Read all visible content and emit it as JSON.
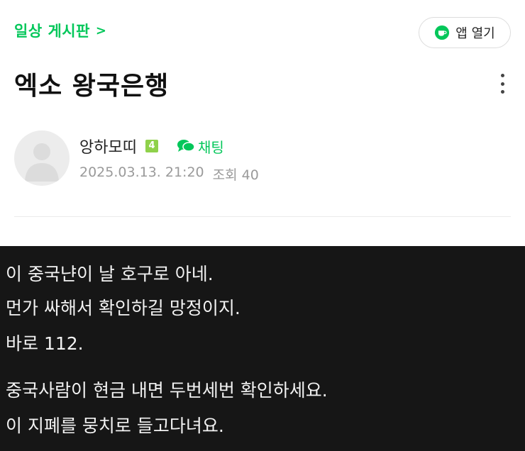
{
  "header": {
    "board_link": "일상 게시판",
    "board_chevron": ">",
    "app_button_label": "앱 열기"
  },
  "post": {
    "title": "엑소 왕국은행",
    "author": "앙하모띠",
    "level": "4",
    "chat_label": "채팅",
    "date": "2025.03.13. 21:20",
    "views": "조회 40"
  },
  "body": {
    "lines": [
      "이 중국냔이 날 호구로 아네.",
      "먼가 싸해서 확인하길 망정이지.",
      "바로 112.",
      "중국사람이 현금 내면 두번세번 확인하세요.",
      "이 지폐를 뭉치로 들고다녀요."
    ]
  },
  "colors": {
    "accent": "#03c75a",
    "level_badge": "#8fd14a",
    "dark_background": "#161616"
  },
  "icons": [
    "coffee-cup-icon",
    "more-vertical-icon",
    "avatar-placeholder-icon",
    "chat-bubble-icon"
  ]
}
